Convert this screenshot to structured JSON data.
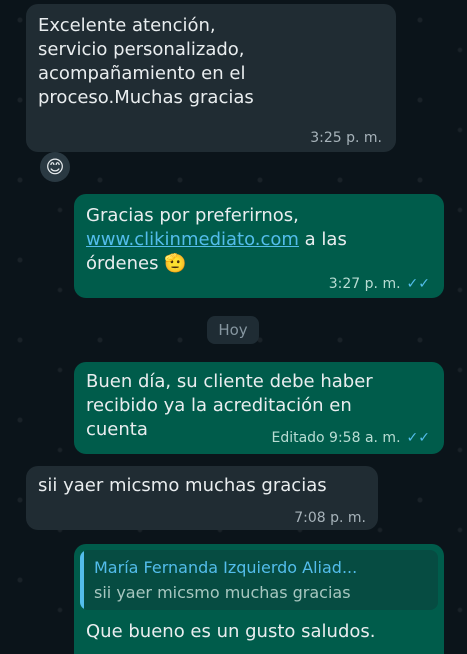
{
  "colors": {
    "background": "#0b141a",
    "incoming_bubble": "#202c33",
    "outgoing_bubble": "#005c4b",
    "link": "#53bdeb",
    "read_check": "#53bdeb"
  },
  "messages": [
    {
      "text": "Excelente atención,\nservicio personalizado,\nacompañamiento en el\nproceso.Muchas gracias",
      "time": "3:25 p. m.",
      "direction": "incoming",
      "reaction": "😊"
    },
    {
      "text_before_link": "Gracias por preferirnos,\n",
      "link": "www.clikinmediato.com",
      "text_after_link": " a las\nórdenes ",
      "emoji": "🫡",
      "time": "3:27 p. m.",
      "direction": "outgoing",
      "read_icon": "double-check-icon"
    },
    {
      "day_label": "Hoy"
    },
    {
      "text": "Buen día, su cliente debe haber\nrecibido ya la acreditación en\ncuenta",
      "time": "Editado 9:58 a. m.",
      "direction": "outgoing",
      "read_icon": "double-check-icon"
    },
    {
      "text": "sii yaer micsmo muchas gracias",
      "time": "7:08 p. m.",
      "direction": "incoming"
    },
    {
      "quoted_author": "María Fernanda Izquierdo Aliad...",
      "quoted_text": "sii yaer micsmo muchas gracias",
      "text": "Que bueno es un gusto saludos.",
      "direction": "outgoing"
    }
  ]
}
